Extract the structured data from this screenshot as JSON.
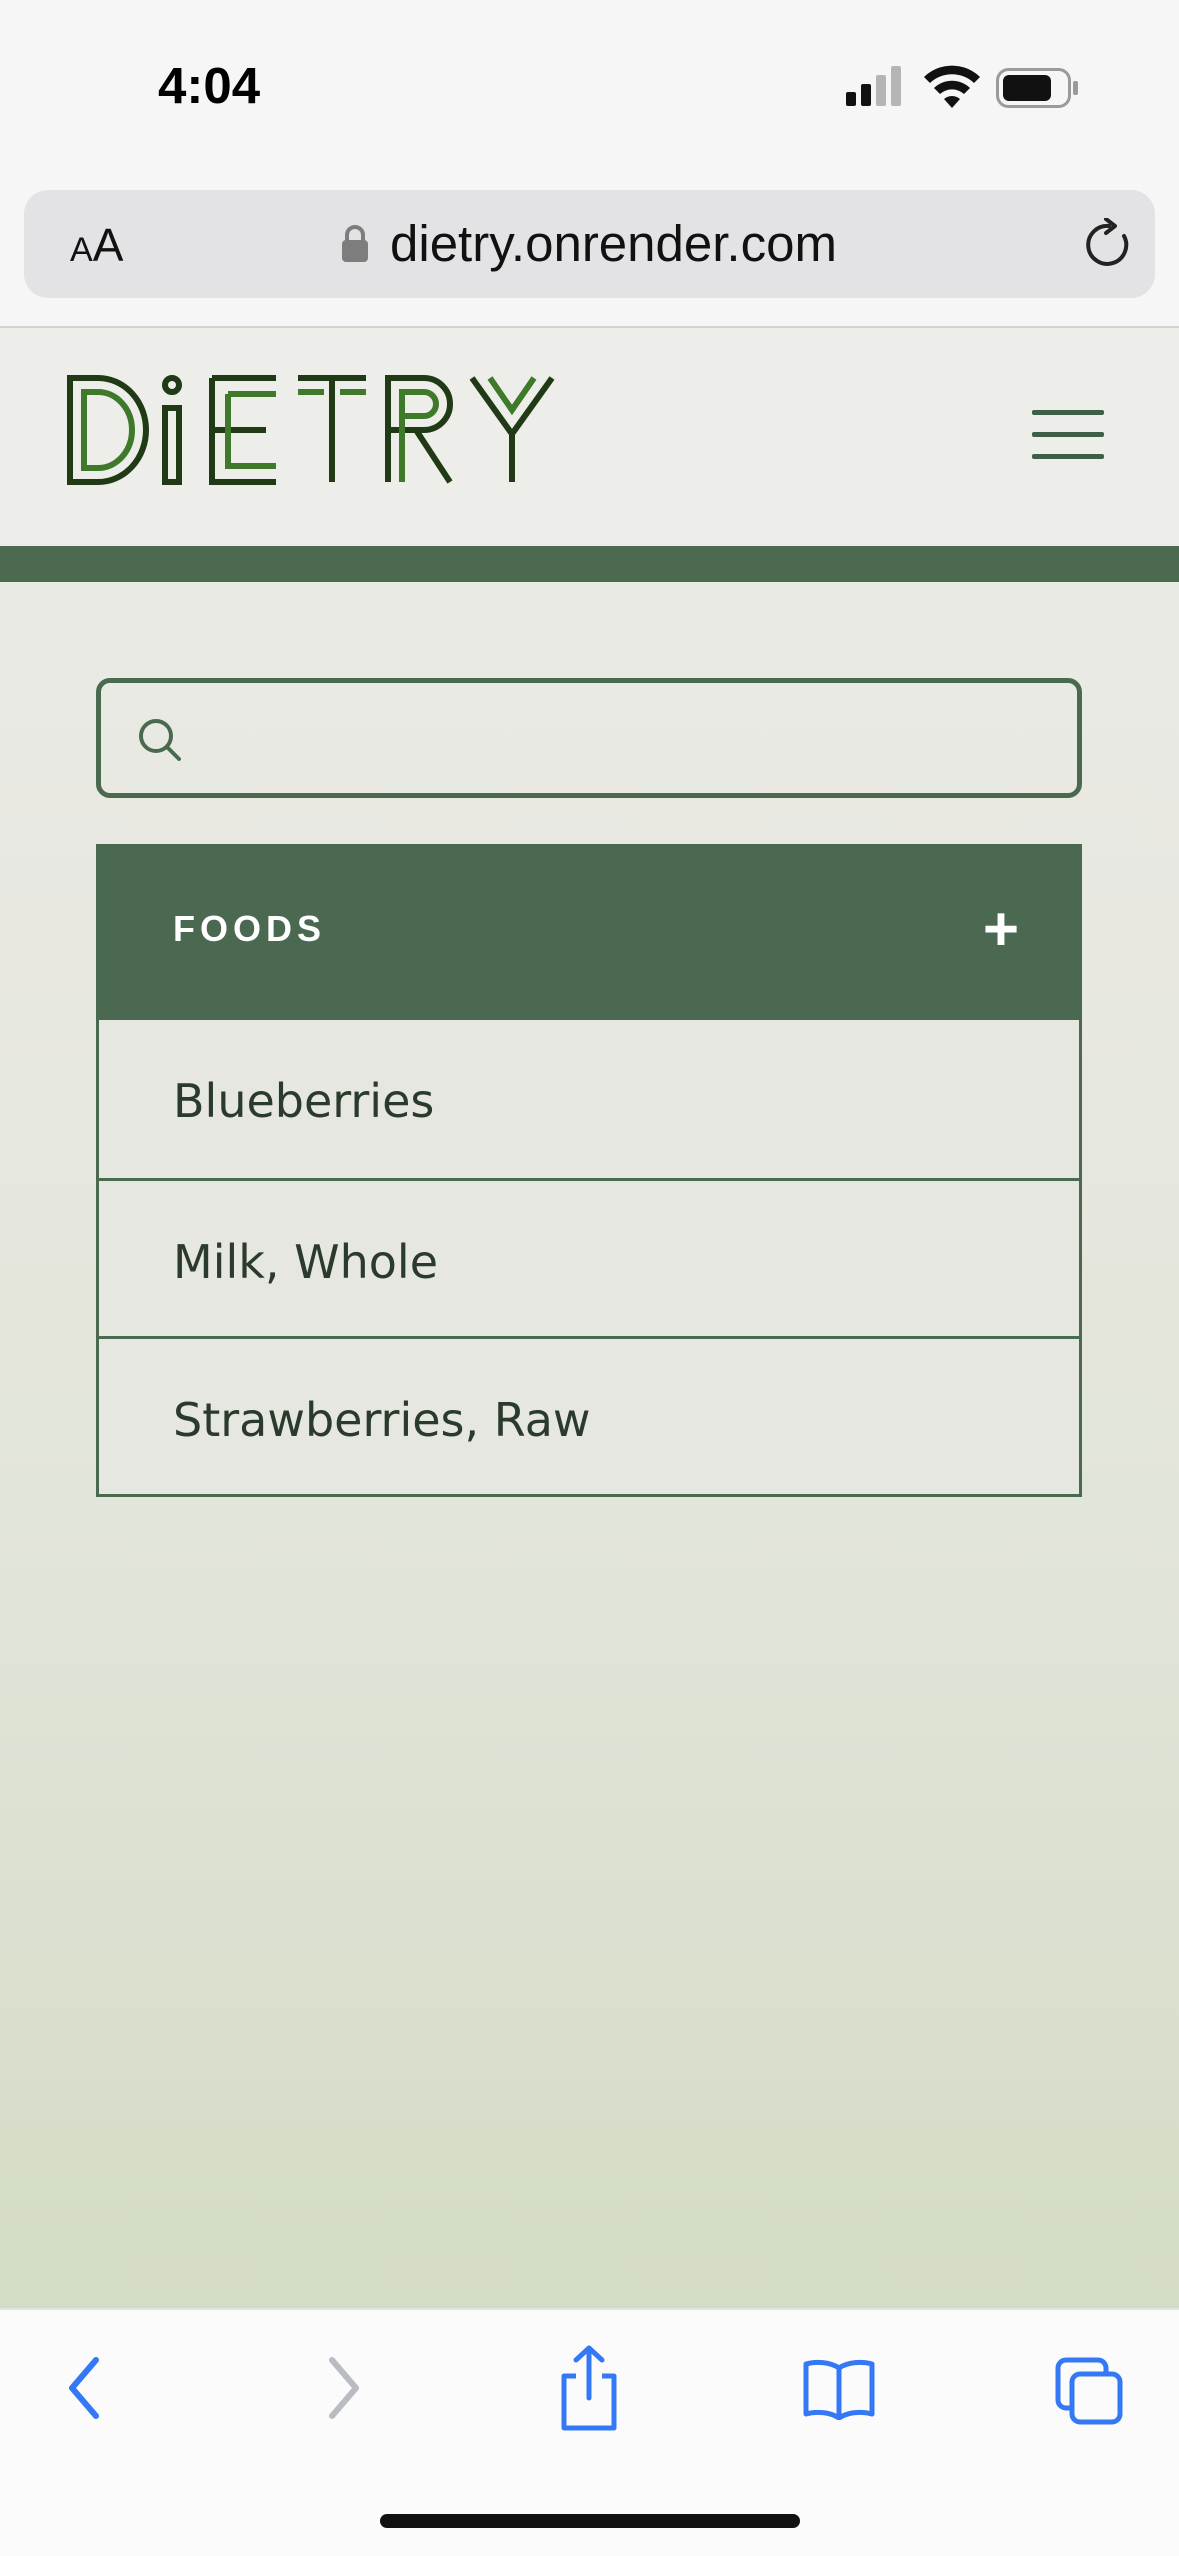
{
  "status_bar": {
    "time": "4:04"
  },
  "browser": {
    "text_size_label_small": "A",
    "text_size_label_large": "A",
    "url": "dietry.onrender.com"
  },
  "site": {
    "logo_text": "DiETRY",
    "search": {
      "value": "",
      "placeholder": ""
    },
    "foods": {
      "title": "FOODS",
      "add_label": "+",
      "items": [
        {
          "label": "Blueberries"
        },
        {
          "label": "Milk, Whole"
        },
        {
          "label": "Strawberries, Raw"
        }
      ]
    }
  },
  "colors": {
    "accent": "#4b6950",
    "logo": "#2f5a1e",
    "ios_blue": "#3478f6"
  },
  "toolbar": {
    "icons": [
      "back-icon",
      "forward-icon",
      "share-icon",
      "bookmarks-icon",
      "tabs-icon"
    ]
  }
}
